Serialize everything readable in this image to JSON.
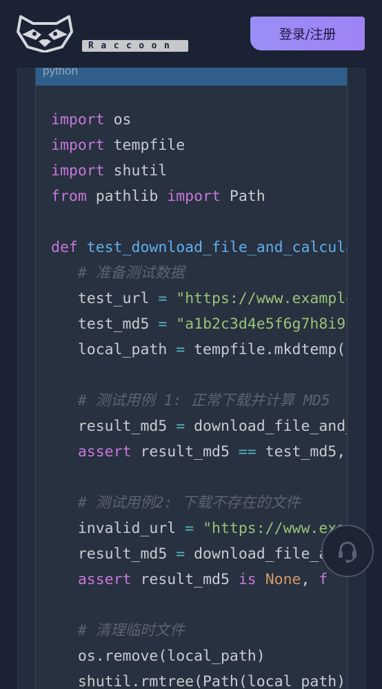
{
  "header": {
    "brand_name": "Raccoon",
    "login_label": "登录/注册"
  },
  "code_block": {
    "language": "python",
    "lines": [
      "import os",
      "import tempfile",
      "import shutil",
      "from pathlib import Path",
      "",
      "def test_download_file_and_calcula",
      "    # 准备测试数据",
      "    test_url = \"https://www.example",
      "    test_md5 = \"a1b2c3d4e5f6g7h8i9j",
      "    local_path = tempfile.mkdtemp(",
      "",
      "    # 测试用例 1: 正常下载并计算 MD5",
      "    result_md5 = download_file_and_",
      "    assert result_md5 == test_md5,",
      "",
      "    # 测试用例2: 下载不存在的文件",
      "    invalid_url = \"https://www.exam",
      "    result_md5 = download_file_and_",
      "    assert result_md5 is None, f",
      "",
      "    # 清理临时文件",
      "    os.remove(local_path)",
      "    shutil.rmtree(Path(local_path)"
    ]
  },
  "support": {
    "icon": "headset-icon"
  }
}
